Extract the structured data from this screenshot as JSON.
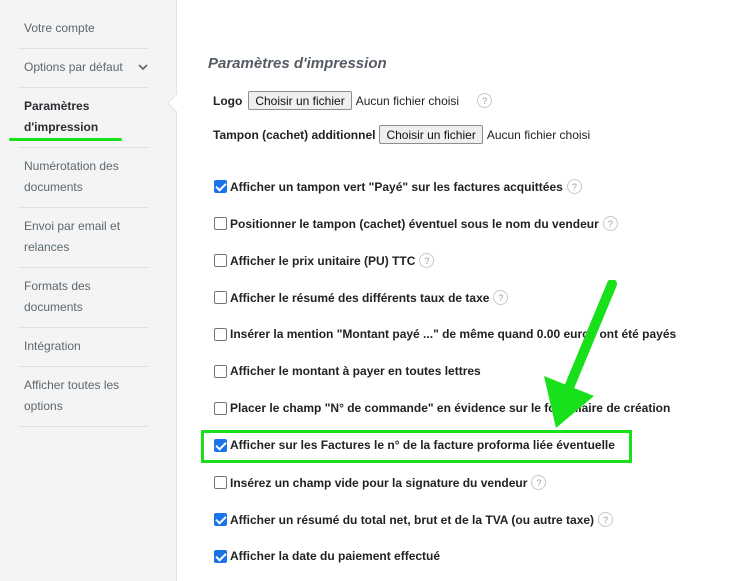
{
  "sidebar": {
    "items": [
      {
        "label": "Votre compte"
      },
      {
        "label": "Options par défaut"
      },
      {
        "label": "Paramètres d'impression"
      },
      {
        "label": "Numérotation des documents"
      },
      {
        "label": "Envoi par email et relances"
      },
      {
        "label": "Formats des documents"
      },
      {
        "label": "Intégration"
      },
      {
        "label": "Afficher toutes les options"
      }
    ]
  },
  "main": {
    "title": "Paramètres d'impression",
    "logo": {
      "label": "Logo",
      "button": "Choisir un fichier",
      "status": "Aucun fichier choisi",
      "help": "?"
    },
    "stamp": {
      "label": "Tampon (cachet) additionnel",
      "button": "Choisir un fichier",
      "status": "Aucun fichier choisi"
    },
    "options": [
      {
        "label": "Afficher un tampon vert \"Payé\" sur les factures acquittées",
        "checked": true,
        "help": "?"
      },
      {
        "label": "Positionner le tampon (cachet) éventuel sous le nom du vendeur",
        "checked": false,
        "help": "?"
      },
      {
        "label": "Afficher le prix unitaire (PU) TTC",
        "checked": false,
        "help": "?"
      },
      {
        "label": "Afficher le résumé des différents taux de taxe",
        "checked": false,
        "help": "?"
      },
      {
        "label": "Insérer la mention \"Montant payé ...\" de même quand 0.00 euros ont été payés",
        "checked": false
      },
      {
        "label": "Afficher le montant à payer en toutes lettres",
        "checked": false
      },
      {
        "label": "Placer le champ \"N° de commande\" en évidence sur le formulaire de création",
        "checked": false
      },
      {
        "label": "Afficher sur les Factures le n° de la facture proforma liée éventuelle",
        "checked": true
      },
      {
        "label": "Insérez un champ vide pour la signature du vendeur",
        "checked": false,
        "help": "?"
      },
      {
        "label": "Afficher un résumé du total net, brut et de la TVA (ou autre taxe)",
        "checked": true,
        "help": "?"
      },
      {
        "label": "Afficher la date du paiement effectué",
        "checked": true
      }
    ]
  },
  "colors": {
    "accent": "#1a73e8",
    "highlight": "#18e01a"
  }
}
